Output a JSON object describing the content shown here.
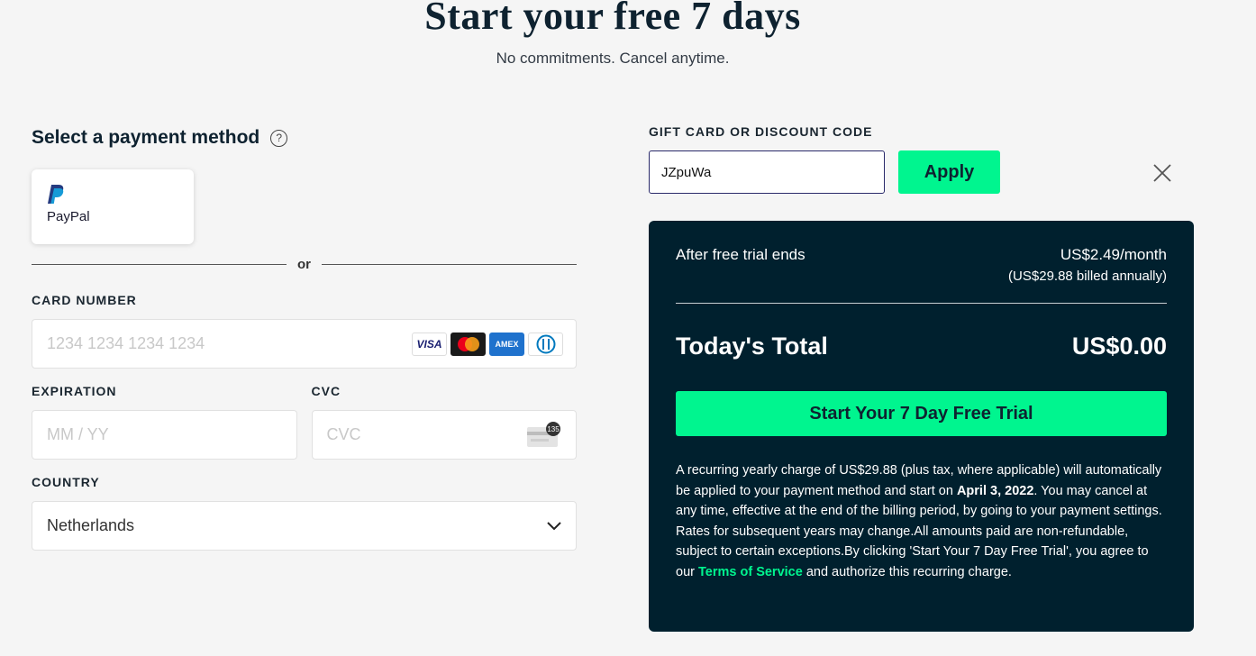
{
  "hero": {
    "title": "Start your free 7 days",
    "subtitle": "No commitments. Cancel anytime."
  },
  "payment": {
    "heading": "Select a payment method",
    "help_icon": "question-circle-icon",
    "paypal_label": "PayPal",
    "or_label": "or",
    "card_number": {
      "label": "CARD NUMBER",
      "placeholder": "1234 1234 1234 1234",
      "brands": [
        "VISA",
        "Mastercard",
        "AMEX",
        "Diners"
      ]
    },
    "expiration": {
      "label": "EXPIRATION",
      "placeholder": "MM / YY"
    },
    "cvc": {
      "label": "CVC",
      "placeholder": "CVC",
      "icon_badge": "135"
    },
    "country": {
      "label": "COUNTRY",
      "value": "Netherlands"
    }
  },
  "gift": {
    "label": "GIFT CARD OR DISCOUNT CODE",
    "value": "JZpuWa",
    "apply_label": "Apply"
  },
  "summary": {
    "after_trial_label": "After free trial ends",
    "price_monthly": "US$2.49/month",
    "price_annual": "(US$29.88 billed annually)",
    "total_label": "Today's Total",
    "total_value": "US$0.00",
    "cta_label": "Start Your 7 Day Free Trial",
    "legal_part1": "A recurring yearly charge of US$29.88 (plus tax, where applicable) will automatically be applied to your payment method and start on ",
    "legal_date": "April 3, 2022",
    "legal_part2": ". You may cancel at any time, effective at the end of the billing period, by going to your payment settings. Rates for subsequent years may change.All amounts paid are non-refundable, subject to certain exceptions.By clicking 'Start Your 7 Day Free Trial', you agree to our ",
    "legal_link": "Terms of Service",
    "legal_part3": " and authorize this recurring charge."
  },
  "colors": {
    "accent_green": "#00f58f",
    "summary_bg": "#00202e",
    "page_bg": "#f5f5f5"
  }
}
